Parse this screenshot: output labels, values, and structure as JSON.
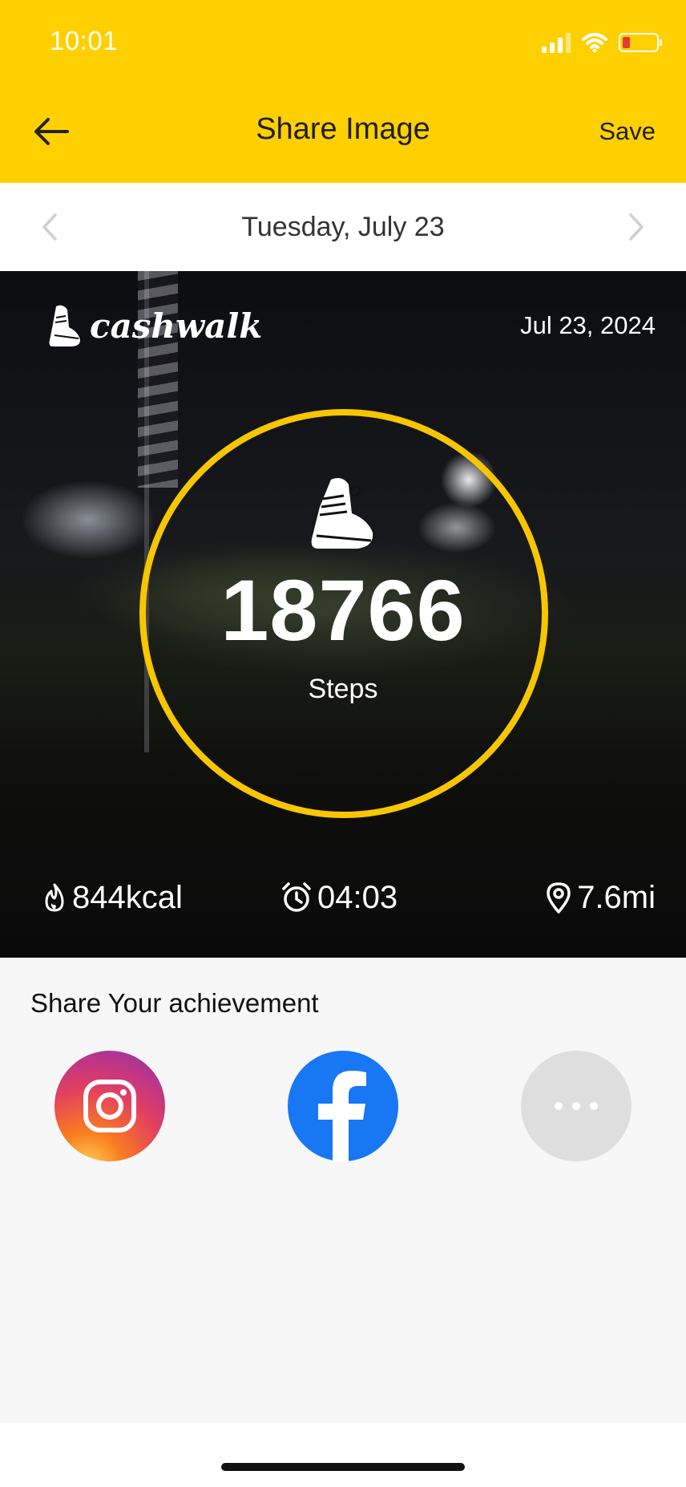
{
  "status_bar": {
    "time": "10:01"
  },
  "header": {
    "title": "Share Image",
    "save_label": "Save"
  },
  "date_nav": {
    "date": "Tuesday, July 23"
  },
  "card": {
    "logo_text": "cashwalk",
    "date": "Jul 23, 2024",
    "steps_value": "18766",
    "steps_label": "Steps",
    "calories": "844kcal",
    "duration": "04:03",
    "distance": "7.6mi"
  },
  "share": {
    "title": "Share Your achievement",
    "buttons": [
      "instagram",
      "facebook",
      "more"
    ]
  },
  "colors": {
    "accent": "#FFD000",
    "ring": "#F7C600",
    "facebook": "#1877F2"
  }
}
